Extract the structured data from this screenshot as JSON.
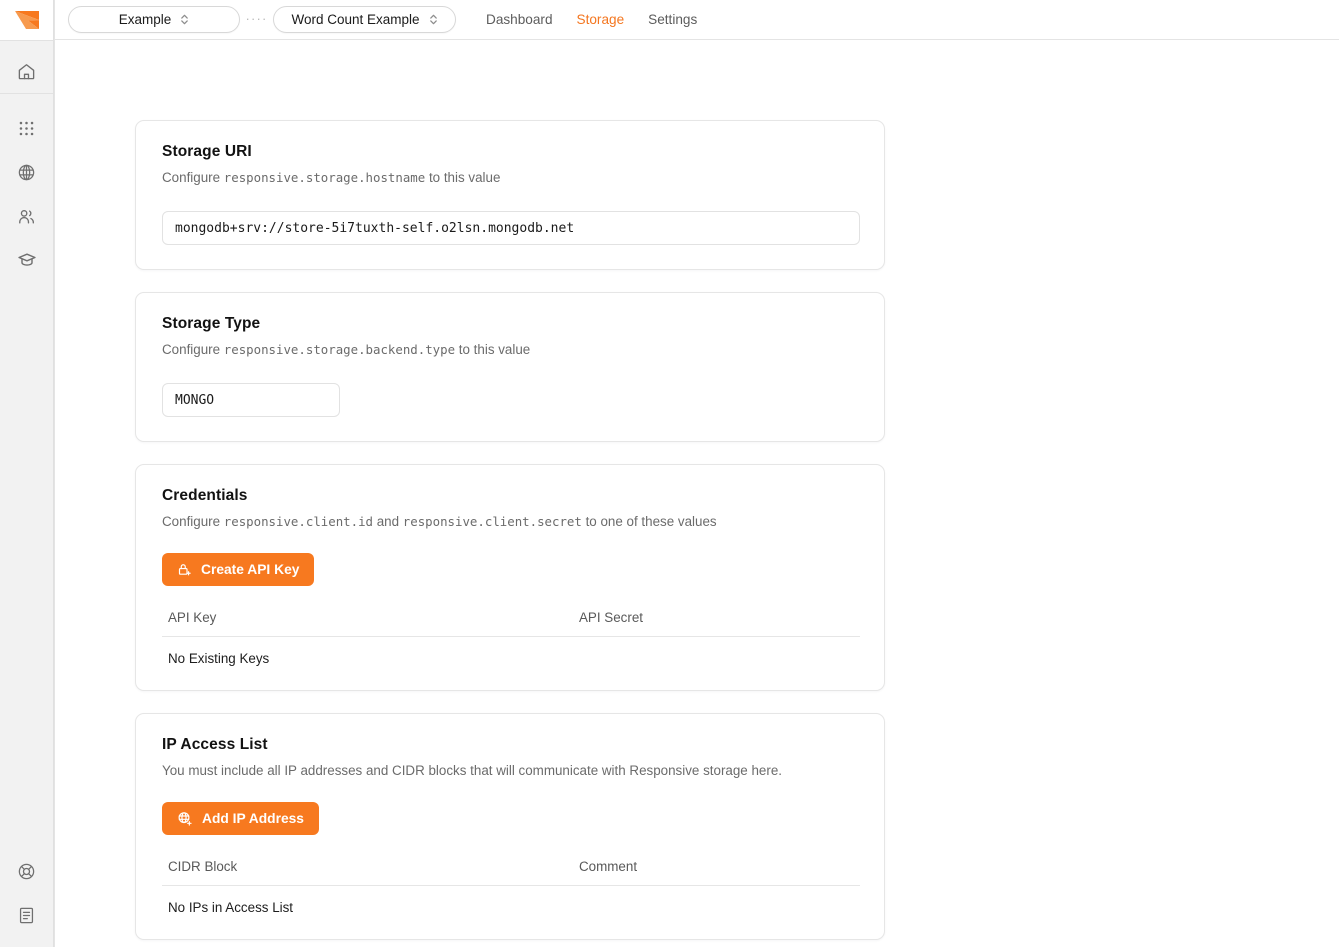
{
  "brand": {
    "logo_icon": "responsive-arrow-logo",
    "accent_color": "#f7791f"
  },
  "rail": {
    "top_items": [
      {
        "icon": "home-icon",
        "name": "home"
      }
    ],
    "main_items": [
      {
        "icon": "grid-apps-icon",
        "name": "applications"
      },
      {
        "icon": "globe-icon",
        "name": "environments"
      },
      {
        "icon": "users-icon",
        "name": "team"
      },
      {
        "icon": "graduation-cap-icon",
        "name": "learn"
      }
    ],
    "bottom_items": [
      {
        "icon": "life-ring-icon",
        "name": "support"
      },
      {
        "icon": "document-icon",
        "name": "docs"
      }
    ]
  },
  "topbar": {
    "org_select": {
      "value": "Example",
      "icon": "chevron-up-down-icon"
    },
    "separator": "····",
    "app_select": {
      "value": "Word Count Example",
      "icon": "chevron-up-down-icon"
    },
    "nav": [
      {
        "label": "Dashboard",
        "active": false
      },
      {
        "label": "Storage",
        "active": true
      },
      {
        "label": "Settings",
        "active": false
      }
    ]
  },
  "cards": {
    "storage_uri": {
      "title": "Storage URI",
      "sub_prefix": "Configure ",
      "sub_code": "responsive.storage.hostname",
      "sub_suffix": " to this value",
      "value": "mongodb+srv://store-5i7tuxth-self.o2lsn.mongodb.net"
    },
    "storage_type": {
      "title": "Storage Type",
      "sub_prefix": "Configure ",
      "sub_code": "responsive.storage.backend.type",
      "sub_suffix": " to this value",
      "value": "MONGO"
    },
    "credentials": {
      "title": "Credentials",
      "sub_prefix": "Configure ",
      "sub_code1": "responsive.client.id",
      "sub_mid": " and ",
      "sub_code2": "responsive.client.secret",
      "sub_suffix": " to one of these values",
      "button": {
        "label": "Create API Key",
        "icon": "lock-plus-icon"
      },
      "table": {
        "columns": [
          "API Key",
          "API Secret"
        ],
        "empty_text": "No Existing Keys",
        "rows": []
      }
    },
    "ip_access_list": {
      "title": "IP Access List",
      "sub": "You must include all IP addresses and CIDR blocks that will communicate with Responsive storage here.",
      "button": {
        "label": "Add IP Address",
        "icon": "globe-plus-icon"
      },
      "table": {
        "columns": [
          "CIDR Block",
          "Comment"
        ],
        "empty_text": "No IPs in Access List",
        "rows": []
      }
    }
  }
}
